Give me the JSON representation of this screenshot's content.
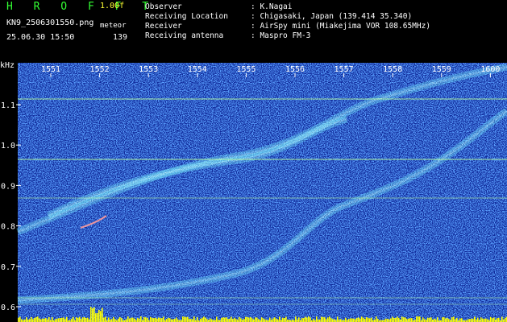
{
  "header": {
    "brand": "H R O F F T",
    "version": "1.00f",
    "filename": "KN9_2506301550.png",
    "mode": "meteor",
    "timestamp": "25.06.30 15:50",
    "count": "139",
    "info": [
      {
        "label": "Observer",
        "value": ": K.Nagai"
      },
      {
        "label": "Receiving Location",
        "value": ": Chigasaki, Japan (139.414 35.340)"
      },
      {
        "label": "Receiver",
        "value": ": AirSpy mini (Miakejima VOR 108.65MHz)"
      },
      {
        "label": "Receiving antenna",
        "value": ": Maspro FM-3"
      }
    ]
  },
  "plot": {
    "y_unit": "kHz",
    "time_ticks": [
      "1551",
      "1552",
      "1553",
      "1554",
      "1555",
      "1556",
      "1557",
      "1558",
      "1559",
      "1600"
    ],
    "freq_ticks": [
      "1.1",
      "1.0",
      "0.9",
      "0.8",
      "0.7",
      "0.6"
    ],
    "colors": {
      "background": "#102a9a",
      "noise": "#3a7bff",
      "signal": "#c8ffff",
      "hline": "#b9ff9a",
      "bar": "#ffff00"
    }
  }
}
